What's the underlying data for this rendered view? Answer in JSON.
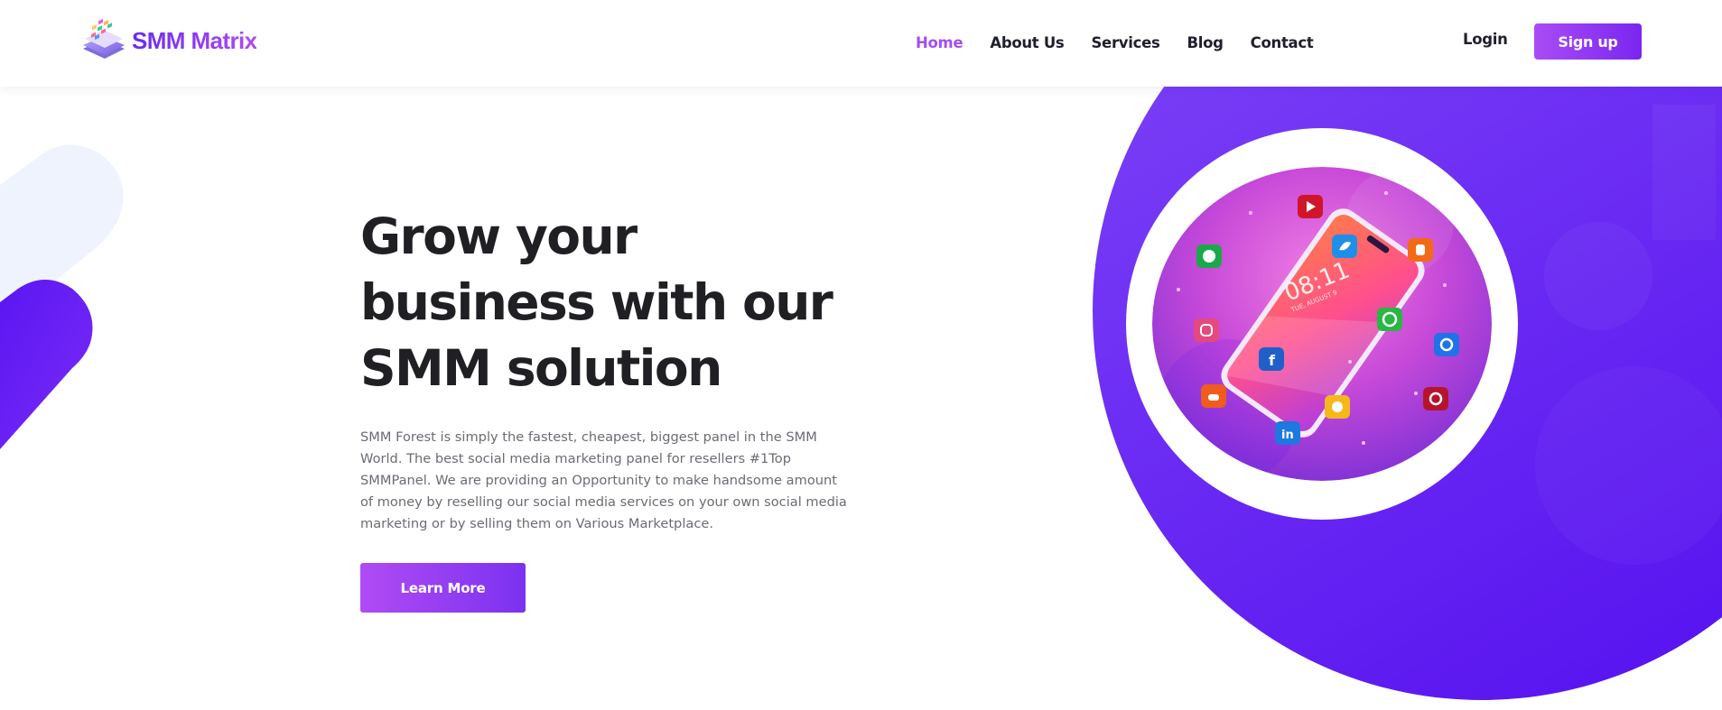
{
  "brand": {
    "name": "SMM Matrix",
    "logo_icon": "stacked-layers-icon"
  },
  "nav": {
    "items": [
      {
        "label": "Home",
        "active": true
      },
      {
        "label": "About Us",
        "active": false
      },
      {
        "label": "Services",
        "active": false
      },
      {
        "label": "Blog",
        "active": false
      },
      {
        "label": "Contact",
        "active": false
      }
    ]
  },
  "auth": {
    "login_label": "Login",
    "signup_label": "Sign up"
  },
  "hero": {
    "title_lines": [
      "Grow your",
      "business with our",
      "SMM solution"
    ],
    "description": "SMM Forest is simply the fastest, cheapest, biggest panel in the SMM World. The best social media marketing panel for resellers #1Top SMMPanel. We are providing an Opportunity to make handsome amount of money by reselling our social media services on your own social media marketing or by selling them on Various Marketplace.",
    "cta_label": "Learn More",
    "phone_time": "08:11",
    "phone_date": "TUE, AUGUST 9",
    "social_icons": [
      "youtube-icon",
      "spotify-icon",
      "twitter-icon",
      "blogger-icon",
      "whatsapp-icon",
      "instagram-icon",
      "facebook-icon",
      "quora-icon",
      "pinterest-icon",
      "soundcloud-icon",
      "snapchat-icon",
      "linkedin-icon"
    ]
  },
  "colors": {
    "accent": "#a54cf0",
    "brand_purple": "#7a26f0",
    "hero_circle": "#6a2af5",
    "text_dark": "#1f1f24",
    "text_muted": "#6b6b76"
  }
}
